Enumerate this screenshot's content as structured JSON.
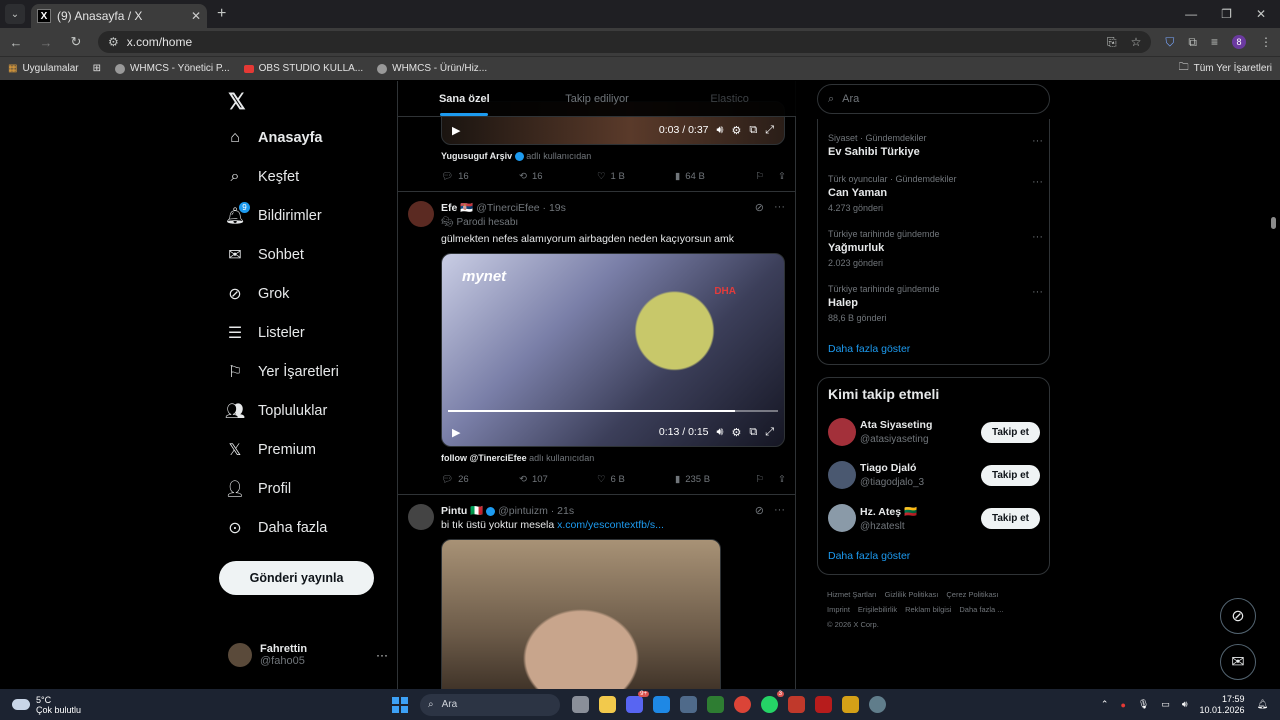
{
  "browser": {
    "tab_title": "(9) Anasayfa / X",
    "url": "x.com/home",
    "bookmarks": [
      "Uygulamalar",
      "WHMCS - Yönetici P...",
      "OBS STUDIO KULLA...",
      "WHMCS - Ürün/Hiz..."
    ],
    "all_bookmarks": "Tüm Yer İşaretleri",
    "profile_initial": "8"
  },
  "nav": {
    "items": [
      {
        "label": "Anasayfa",
        "icon": "home-icon"
      },
      {
        "label": "Keşfet",
        "icon": "search-icon"
      },
      {
        "label": "Bildirimler",
        "icon": "bell-icon",
        "badge": "9"
      },
      {
        "label": "Sohbet",
        "icon": "mail-icon"
      },
      {
        "label": "Grok",
        "icon": "grok-icon"
      },
      {
        "label": "Listeler",
        "icon": "list-icon"
      },
      {
        "label": "Yer İşaretleri",
        "icon": "bookmark-icon"
      },
      {
        "label": "Topluluklar",
        "icon": "people-icon"
      },
      {
        "label": "Premium",
        "icon": "x-icon"
      },
      {
        "label": "Profil",
        "icon": "person-icon"
      },
      {
        "label": "Daha fazla",
        "icon": "more-circle-icon"
      }
    ],
    "post_button": "Gönderi yayınla",
    "user_name": "Fahrettin",
    "user_handle": "@faho05"
  },
  "feed": {
    "tabs": [
      "Sana özel",
      "Takip ediliyor",
      "Elastico"
    ],
    "tweet0": {
      "video_time": "0:03 / 0:37",
      "source_name": "Yugusuguf Arşiv",
      "source_suffix": "adlı kullanıcıdan",
      "replies": "16",
      "reposts": "16",
      "likes": "1 B",
      "views": "64 B"
    },
    "tweet1": {
      "name": "Efe 🇷🇸",
      "handle_time": "@TinerciEfee · 19s",
      "parody": "Parodi hesabı",
      "text": "gülmekten nefes alamıyorum airbagden neden kaçıyorsun amk",
      "video_brand": "mynet",
      "video_tag": "DHA",
      "video_time": "0:13 / 0:15",
      "video_progress": 0.87,
      "source_name": "follow @TinerciEfee",
      "source_suffix": "adlı kullanıcıdan",
      "replies": "26",
      "reposts": "107",
      "likes": "6 B",
      "views": "235 B"
    },
    "tweet2": {
      "name": "Pintu 🇮🇹",
      "handle_time": "@pintuizm · 21s",
      "text": "bi tık üstü yoktur mesela",
      "link": "x.com/yescontextfb/s..."
    }
  },
  "right": {
    "search_placeholder": "Ara",
    "trends": [
      {
        "cat": "Siyaset · Gündemdekiler",
        "name": "Ev Sahibi Türkiye",
        "count": ""
      },
      {
        "cat": "Türk oyuncular · Gündemdekiler",
        "name": "Can Yaman",
        "count": "4.273 gönderi"
      },
      {
        "cat": "Türkiye tarihinde gündemde",
        "name": "Yağmurluk",
        "count": "2.023 gönderi"
      },
      {
        "cat": "Türkiye tarihinde gündemde",
        "name": "Halep",
        "count": "88,6 B gönderi"
      }
    ],
    "show_more": "Daha fazla göster",
    "who_title": "Kimi takip etmeli",
    "who": [
      {
        "name": "Ata Siyaseting",
        "handle": "@atasiyaseting",
        "btn": "Takip et"
      },
      {
        "name": "Tiago Djaló",
        "handle": "@tiagodjalo_3",
        "btn": "Takip et"
      },
      {
        "name": "Hz. Ateş 🇱🇹",
        "handle": "@hzateslt",
        "btn": "Takip et"
      }
    ],
    "show_more2": "Daha fazla göster",
    "footer": [
      "Hizmet Şartları",
      "Gizlilik Politikası",
      "Çerez Politikası",
      "Imprint",
      "Erişilebilirlik",
      "Reklam bilgisi",
      "Daha fazla ...",
      "© 2026 X Corp."
    ]
  },
  "taskbar": {
    "temp": "5°C",
    "weather": "Çok bulutlu",
    "search": "Ara",
    "time": "17:59",
    "date": "10.01.2026"
  },
  "colors": {
    "accent": "#1d9bf0",
    "bg": "#000000",
    "border": "#2f3336"
  }
}
